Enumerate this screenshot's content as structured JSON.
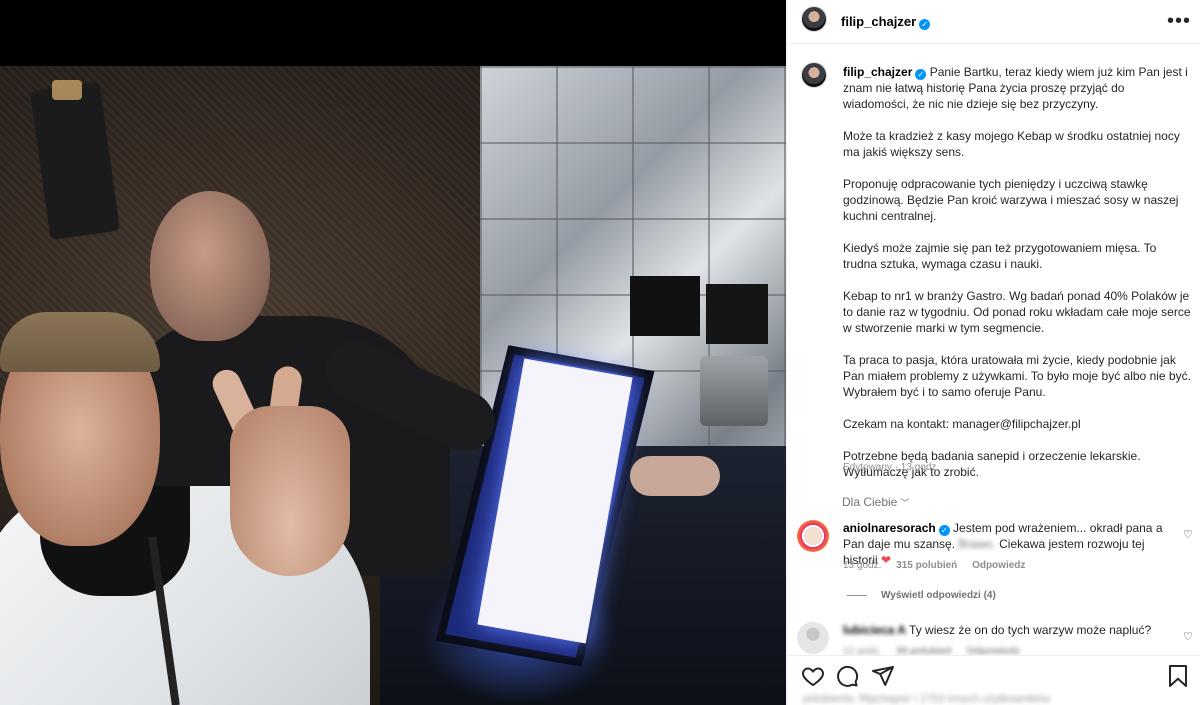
{
  "post": {
    "username": "filip_chajzer",
    "verified_mark": "✓",
    "more": "•••"
  },
  "caption": {
    "username": "filip_chajzer",
    "paragraphs": [
      "Panie Bartku, teraz kiedy wiem już kim Pan jest i znam nie łatwą historię Pana życia proszę przyjąć do wiadomości, że nic nie dzieje się bez przyczyny.",
      "Może ta kradzież z kasy mojego Kebap w środku ostatniej nocy ma jakiś większy sens.",
      "Proponuję odpracowanie tych pieniędzy i uczciwą stawkę godzinową. Będzie Pan kroić warzywa i mieszać sosy w naszej kuchni centralnej.",
      "Kiedyś może zajmie się pan też przygotowaniem mięsa. To trudna sztuka, wymaga czasu i nauki.",
      "Kebap to nr1 w branży Gastro. Wg badań ponad 40% Polaków je to danie raz w tygodniu. Od ponad roku wkładam całe moje serce w stworzenie marki w tym segmencie.",
      "Ta praca to pasja, która uratowała mi życie, kiedy podobnie jak Pan miałem problemy z używkami. To było moje być albo nie być. Wybrałem być i to samo oferuje Panu.",
      "Czekam na kontakt: manager@filipchajzer.pl",
      "Potrzebne będą badania sanepid i orzeczenie lekarskie. Wytłumaczę jak to zrobić."
    ],
    "meta": "Edytowany · 13 godz."
  },
  "filter": {
    "label": "Dla Ciebie",
    "chevron": "﹀"
  },
  "comments": [
    {
      "username": "aniolnaresorach",
      "text_pre": "Jestem pod wrażeniem... okradł pana a Pan daje mu szansę.",
      "text_blur": "Brawo.",
      "text_post": "Ciekawa jestem rozwoju tej historii",
      "time": "13 godz.",
      "likes": "315 polubień",
      "reply": "Odpowiedz",
      "view_replies": "Wyświetl odpowiedzi (4)"
    },
    {
      "username": "lubicieca A",
      "text": "Ty wiesz że on do tych warzyw może napluć?",
      "time": "12 godz.",
      "likes": "39 polubień",
      "reply": "Odpowiedz"
    }
  ],
  "bottom_preview": "polubienia: filipchajzer i 1753 innych użytkowników"
}
